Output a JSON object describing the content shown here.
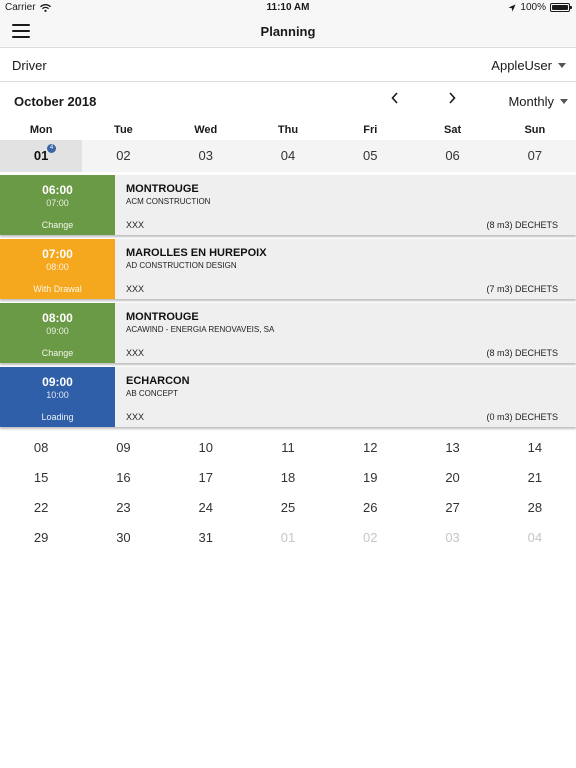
{
  "status_bar": {
    "carrier": "Carrier",
    "time": "11:10 AM",
    "battery": "100%",
    "battery_level": 1.0
  },
  "nav": {
    "title": "Planning",
    "menu_icon": "hamburger-menu-icon"
  },
  "driver": {
    "label": "Driver",
    "user": "AppleUser"
  },
  "calendar": {
    "month_title": "October 2018",
    "view_mode": "Monthly",
    "weekdays": [
      "Mon",
      "Tue",
      "Wed",
      "Thu",
      "Fri",
      "Sat",
      "Sun"
    ],
    "week1": [
      "01",
      "02",
      "03",
      "04",
      "05",
      "06",
      "07"
    ],
    "selected_badge": "4",
    "weeks": [
      [
        "08",
        "09",
        "10",
        "11",
        "12",
        "13",
        "14"
      ],
      [
        "15",
        "16",
        "17",
        "18",
        "19",
        "20",
        "21"
      ],
      [
        "22",
        "23",
        "24",
        "25",
        "26",
        "27",
        "28"
      ],
      [
        "29",
        "30",
        "31",
        "01",
        "02",
        "03",
        "04"
      ]
    ]
  },
  "events": [
    {
      "start": "06:00",
      "end": "07:00",
      "type": "Change",
      "city": "MONTROUGE",
      "company": "ACM CONSTRUCTION",
      "ref": "XXX",
      "volume": "(8 m3) DECHETS",
      "color": "#6a9a46"
    },
    {
      "start": "07:00",
      "end": "08:00",
      "type": "With Drawal",
      "city": "MAROLLES EN HUREPOIX",
      "company": "AD CONSTRUCTION DESIGN",
      "ref": "XXX",
      "volume": "(7 m3) DECHETS",
      "color": "#f5a81e"
    },
    {
      "start": "08:00",
      "end": "09:00",
      "type": "Change",
      "city": "MONTROUGE",
      "company": "ACAWIND - ENERGIA RENOVAVEIS, SA",
      "ref": "XXX",
      "volume": "(8 m3) DECHETS",
      "color": "#6a9a46"
    },
    {
      "start": "09:00",
      "end": "10:00",
      "type": "Loading",
      "city": "ECHARCON",
      "company": "AB CONCEPT",
      "ref": "XXX",
      "volume": "(0 m3) DECHETS",
      "color": "#2f5fa8"
    }
  ]
}
